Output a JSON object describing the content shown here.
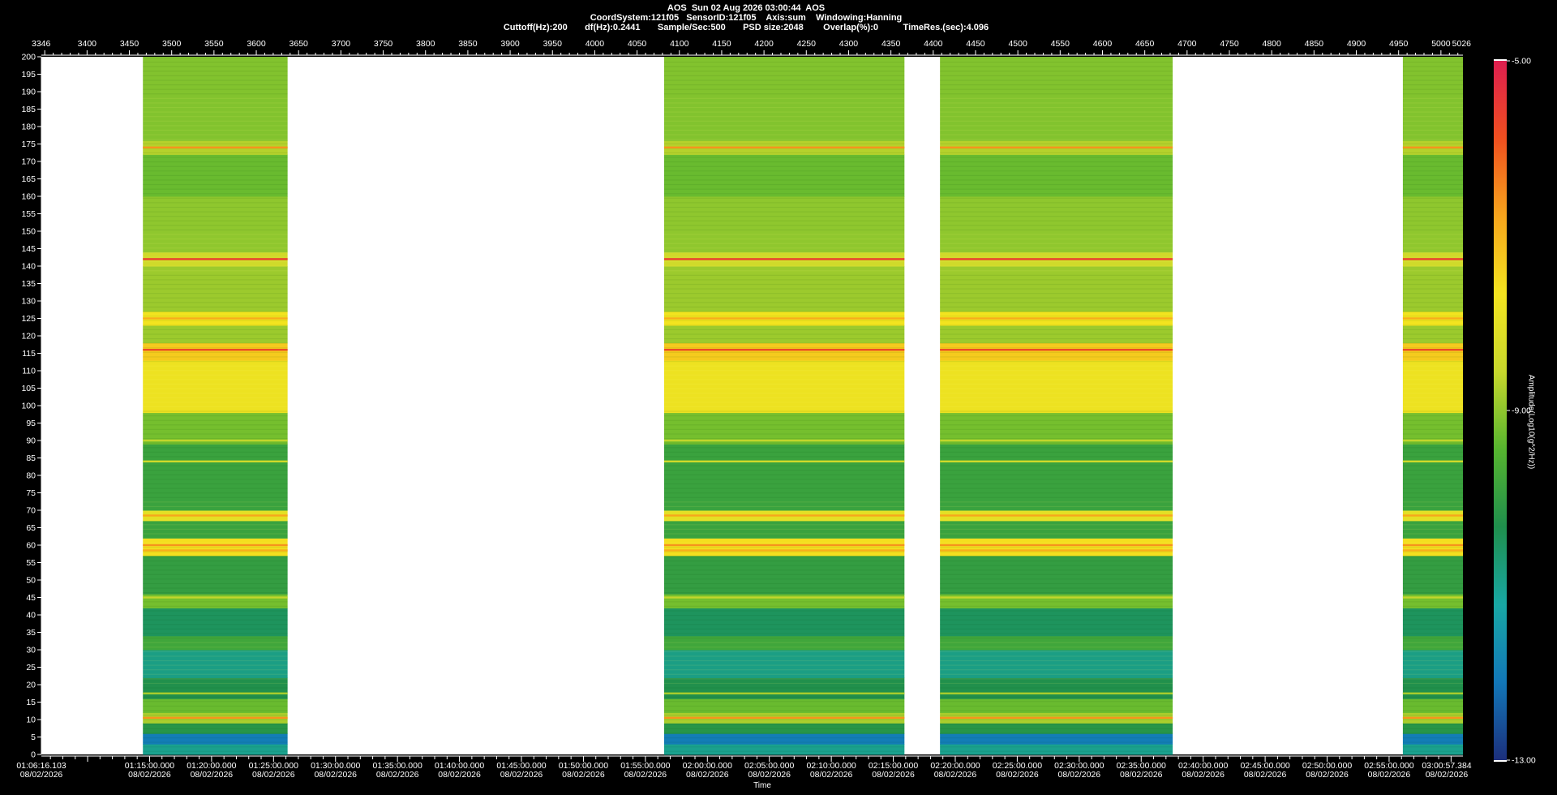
{
  "header": {
    "line1": "AOS  Sun 02 Aug 2026 03:00:44  AOS",
    "line2": "CoordSystem:121f05   SensorID:121f05    Axis:sum    Windowing:Hanning",
    "line3": "Cuttoff(Hz):200       df(Hz):0.2441       Sample/Sec:500       PSD size:2048        Overlap(%):0          TimeRes.(sec):4.096"
  },
  "colorbar": {
    "label": "Amplitude(Log10(g^2/Hz))",
    "ticks": [
      "-5.00",
      "-9.00",
      "-13.00"
    ],
    "min": -13,
    "max": -5,
    "colors": [
      "#1c2f7c",
      "#1277b8",
      "#18a7a4",
      "#1f8f4d",
      "#56b52f",
      "#c8d82c",
      "#f4e41f",
      "#f7a51c",
      "#f04f1f",
      "#dd1e4f"
    ]
  },
  "chart_data": {
    "type": "heatmap",
    "xlabel": "Time",
    "ylabel": "",
    "ylim": [
      0,
      200
    ],
    "yticks": [
      0,
      5,
      10,
      15,
      20,
      25,
      30,
      35,
      40,
      45,
      50,
      55,
      60,
      65,
      70,
      75,
      80,
      85,
      90,
      95,
      100,
      105,
      110,
      115,
      120,
      125,
      130,
      135,
      140,
      145,
      150,
      155,
      160,
      165,
      170,
      175,
      180,
      185,
      190,
      195,
      200
    ],
    "top_axis": {
      "range": [
        3346,
        5026
      ],
      "ticks": [
        3346,
        3400,
        3450,
        3500,
        3550,
        3600,
        3650,
        3700,
        3750,
        3800,
        3850,
        3900,
        3950,
        4000,
        4050,
        4100,
        4150,
        4200,
        4250,
        4300,
        4350,
        4400,
        4450,
        4500,
        4550,
        4600,
        4650,
        4700,
        4750,
        4800,
        4850,
        4900,
        4950,
        5000,
        5026
      ]
    },
    "bottom_axis": {
      "start": "01:06:16.103",
      "end": "03:00:57.384",
      "date": "08/02/2026",
      "ticks": [
        {
          "time": "01:06:16.103",
          "date": "08/02/2026"
        },
        {
          "time": "01:15:00.000",
          "date": "08/02/2026"
        },
        {
          "time": "01:20:00.000",
          "date": "08/02/2026"
        },
        {
          "time": "01:25:00.000",
          "date": "08/02/2026"
        },
        {
          "time": "01:30:00.000",
          "date": "08/02/2026"
        },
        {
          "time": "01:35:00.000",
          "date": "08/02/2026"
        },
        {
          "time": "01:40:00.000",
          "date": "08/02/2026"
        },
        {
          "time": "01:45:00.000",
          "date": "08/02/2026"
        },
        {
          "time": "01:50:00.000",
          "date": "08/02/2026"
        },
        {
          "time": "01:55:00.000",
          "date": "08/02/2026"
        },
        {
          "time": "02:00:00.000",
          "date": "08/02/2026"
        },
        {
          "time": "02:05:00.000",
          "date": "08/02/2026"
        },
        {
          "time": "02:10:00.000",
          "date": "08/02/2026"
        },
        {
          "time": "02:15:00.000",
          "date": "08/02/2026"
        },
        {
          "time": "02:20:00.000",
          "date": "08/02/2026"
        },
        {
          "time": "02:25:00.000",
          "date": "08/02/2026"
        },
        {
          "time": "02:30:00.000",
          "date": "08/02/2026"
        },
        {
          "time": "02:35:00.000",
          "date": "08/02/2026"
        },
        {
          "time": "02:40:00.000",
          "date": "08/02/2026"
        },
        {
          "time": "02:45:00.000",
          "date": "08/02/2026"
        },
        {
          "time": "02:50:00.000",
          "date": "08/02/2026"
        },
        {
          "time": "02:55:00.000",
          "date": "08/02/2026"
        },
        {
          "time": "03:00:57.384",
          "date": "08/02/2026"
        }
      ]
    },
    "data_segments": [
      {
        "start": 3466,
        "end": 3637
      },
      {
        "start": 4082,
        "end": 4366
      },
      {
        "start": 4408,
        "end": 4683
      },
      {
        "start": 4955,
        "end": 5026
      }
    ],
    "spectral_bands": [
      {
        "from": 0,
        "to": 3,
        "level": -11.0
      },
      {
        "from": 3,
        "to": 6,
        "level": -12.0
      },
      {
        "from": 6,
        "to": 9,
        "level": -10.2
      },
      {
        "from": 9,
        "to": 12,
        "level": -8.8
      },
      {
        "from": 12,
        "to": 16,
        "level": -9.3
      },
      {
        "from": 16,
        "to": 22,
        "level": -10.3
      },
      {
        "from": 22,
        "to": 30,
        "level": -10.9
      },
      {
        "from": 30,
        "to": 34,
        "level": -9.8
      },
      {
        "from": 34,
        "to": 42,
        "level": -10.5
      },
      {
        "from": 42,
        "to": 46,
        "level": -9.2
      },
      {
        "from": 46,
        "to": 57,
        "level": -10.0
      },
      {
        "from": 57,
        "to": 62,
        "level": -7.6
      },
      {
        "from": 62,
        "to": 67,
        "level": -9.9
      },
      {
        "from": 67,
        "to": 70,
        "level": -8.0
      },
      {
        "from": 70,
        "to": 89,
        "level": -9.9
      },
      {
        "from": 89,
        "to": 98,
        "level": -9.2
      },
      {
        "from": 98,
        "to": 113,
        "level": -7.8
      },
      {
        "from": 113,
        "to": 118,
        "level": -7.3
      },
      {
        "from": 118,
        "to": 123,
        "level": -8.9
      },
      {
        "from": 123,
        "to": 127,
        "level": -7.7
      },
      {
        "from": 127,
        "to": 140,
        "level": -8.9
      },
      {
        "from": 140,
        "to": 144,
        "level": -8.4
      },
      {
        "from": 144,
        "to": 160,
        "level": -9.0
      },
      {
        "from": 160,
        "to": 172,
        "level": -9.3
      },
      {
        "from": 172,
        "to": 176,
        "level": -8.7
      },
      {
        "from": 176,
        "to": 200,
        "level": -9.1
      }
    ],
    "tonal_lines": [
      {
        "freq": 10.5,
        "level": -6.6
      },
      {
        "freq": 17.5,
        "level": -8.8
      },
      {
        "freq": 45,
        "level": -8.6
      },
      {
        "freq": 58.5,
        "level": -6.9
      },
      {
        "freq": 60,
        "level": -6.6
      },
      {
        "freq": 68.5,
        "level": -6.8
      },
      {
        "freq": 84,
        "level": -8.4
      },
      {
        "freq": 90,
        "level": -8.6
      },
      {
        "freq": 116,
        "level": -5.8
      },
      {
        "freq": 125,
        "level": -6.9
      },
      {
        "freq": 142,
        "level": -5.6
      },
      {
        "freq": 174,
        "level": -6.6
      }
    ]
  }
}
